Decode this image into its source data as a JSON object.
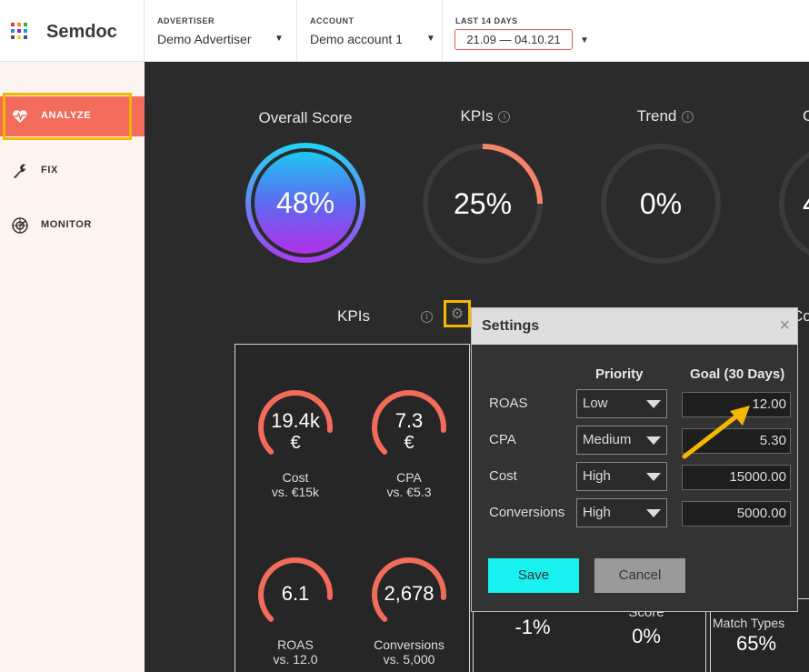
{
  "brand": {
    "name": "Semdoc",
    "logo_colors": [
      "#e53935",
      "#fb8c00",
      "#43a047",
      "#1e88e5",
      "#8e24aa",
      "#00acc1",
      "#6d4c41",
      "#fdd835",
      "#3949ab"
    ]
  },
  "header": {
    "advertiser": {
      "label": "ADVERTISER",
      "value": "Demo Advertiser"
    },
    "account": {
      "label": "ACCOUNT",
      "value": "Demo account 1"
    },
    "date": {
      "label": "LAST 14 DAYS",
      "value": "21.09 — 04.10.21"
    }
  },
  "sidebar": {
    "items": [
      {
        "label": "ANALYZE",
        "icon": "heart-pulse-icon",
        "active": true
      },
      {
        "label": "FIX",
        "icon": "wrench-icon",
        "active": false
      },
      {
        "label": "MONITOR",
        "icon": "radar-icon",
        "active": false
      }
    ]
  },
  "scores": {
    "overall": {
      "title": "Overall Score",
      "value": "48%",
      "fraction": 0.48
    },
    "kpis": {
      "title": "KPIs",
      "value": "25%",
      "fraction": 0.25
    },
    "trend": {
      "title": "Trend",
      "value": "0%",
      "fraction": 0.0
    },
    "fourth_partial": {
      "title": "C",
      "value": "4"
    }
  },
  "kpi_panel": {
    "title": "KPIs",
    "gauges": [
      {
        "value": "19.4k",
        "unit": "€",
        "name": "Cost",
        "vs": "vs. €15k",
        "fraction": 0.85
      },
      {
        "value": "7.3",
        "unit": "€",
        "name": "CPA",
        "vs": "vs. €5.3",
        "fraction": 0.85
      },
      {
        "value": "6.1",
        "unit": "",
        "name": "ROAS",
        "vs": "vs. 12.0",
        "fraction": 0.85
      },
      {
        "value": "2,678",
        "unit": "",
        "name": "Conversions",
        "vs": "vs. 5,000",
        "fraction": 0.85
      }
    ]
  },
  "right_partial": {
    "co_label": "Co",
    "trend_value": "-1%",
    "score_label": "Score",
    "score_value": "0%",
    "match_label": "Match Types",
    "match_value": "65%"
  },
  "settings": {
    "title": "Settings",
    "close": "×",
    "col_priority": "Priority",
    "col_goal": "Goal (30 Days)",
    "rows": [
      {
        "label": "ROAS",
        "priority": "Low",
        "goal": "12.00"
      },
      {
        "label": "CPA",
        "priority": "Medium",
        "goal": "5.30"
      },
      {
        "label": "Cost",
        "priority": "High",
        "goal": "15000.00"
      },
      {
        "label": "Conversions",
        "priority": "High",
        "goal": "5000.00"
      }
    ],
    "save": "Save",
    "cancel": "Cancel"
  },
  "colors": {
    "accent": "#f26b5b",
    "highlight": "#f5b700",
    "save": "#19f0f0",
    "ring_track": "#3a3a3a"
  }
}
